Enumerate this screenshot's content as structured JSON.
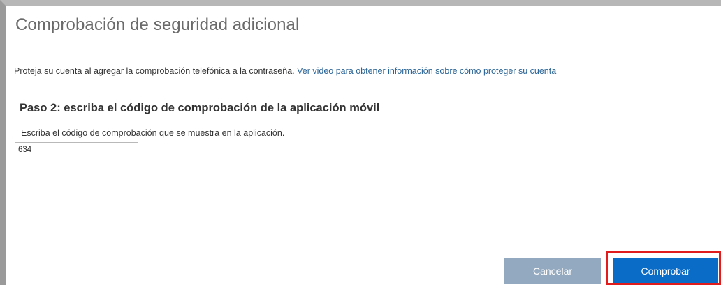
{
  "page": {
    "title": "Comprobación de seguridad adicional"
  },
  "intro": {
    "text": "Proteja su cuenta al agregar la comprobación telefónica a la contraseña.",
    "link": "Ver video para obtener información sobre cómo proteger su cuenta"
  },
  "step": {
    "heading": "Paso 2: escriba el código de comprobación de la aplicación móvil",
    "instruction": "Escriba el código de comprobación que se muestra en la aplicación.",
    "code_value": "634"
  },
  "buttons": {
    "cancel": "Cancelar",
    "verify": "Comprobar"
  },
  "colors": {
    "link": "#2a6496",
    "cancel_button": "#93a9bf",
    "verify_button": "#0a6cc6",
    "highlight": "#e01c1c"
  }
}
